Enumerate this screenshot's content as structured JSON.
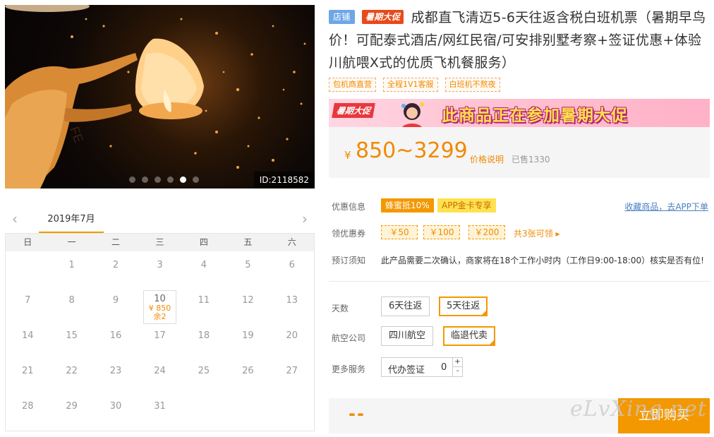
{
  "photo": {
    "id_label": "ID:2118582",
    "dots_count": 6,
    "active_dot_index": 4
  },
  "calendar": {
    "prev_icon": "chevron-left-icon",
    "next_icon": "chevron-right-icon",
    "month_label": "2019年7月",
    "weekdays": [
      "日",
      "一",
      "二",
      "三",
      "四",
      "五",
      "六"
    ],
    "days": [
      "",
      "1",
      "2",
      "3",
      "4",
      "5",
      "6",
      "7",
      "8",
      "9",
      "10",
      "11",
      "12",
      "13",
      "14",
      "15",
      "16",
      "17",
      "18",
      "19",
      "20",
      "21",
      "22",
      "23",
      "24",
      "25",
      "26",
      "27",
      "28",
      "29",
      "30",
      "31"
    ],
    "available": {
      "day": "10",
      "price": "¥ 850",
      "stock": "余2"
    }
  },
  "product": {
    "tag_shop": "店铺",
    "tag_promo": "暑期大促",
    "title": "成都直飞清迈5-6天往返含税白班机票（暑期早鸟价！可配泰式酒店/网红民宿/可安排别墅考察+签证优惠+体验川航喂X式的优质飞机餐服务）",
    "features": [
      "包机商直营",
      "全程1V1客服",
      "白班机不熬夜"
    ]
  },
  "banner": {
    "tag": "暑期大促",
    "text": "此商品正在参加暑期大促"
  },
  "price": {
    "currency": "¥",
    "range": "850~3299",
    "note_link": "价格说明",
    "sold": "已售1330"
  },
  "info": {
    "discount_label": "优惠信息",
    "discount_badge": "蜂蜜抵10%",
    "app_badge": "APP金卡专享",
    "favorite_link": "收藏商品，去APP下单",
    "coupon_label": "领优惠券",
    "coupons": [
      "￥50",
      "￥100",
      "￥200"
    ],
    "coupon_more": "共3张可领 ▸",
    "notice_label": "预订须知",
    "notice_text": "此产品需要二次确认，商家将在18个工作小时内（工作日9:00-18:00）核实是否有位!"
  },
  "options": {
    "days_label": "天数",
    "days": [
      "6天往返",
      "5天往返"
    ],
    "days_selected": 1,
    "airline_label": "航空公司",
    "airlines": [
      "四川航空",
      "临退代卖"
    ],
    "airline_selected": 1,
    "service_label": "更多服务",
    "service_name": "代办签证",
    "service_qty": "0",
    "plus": "+",
    "minus": "-"
  },
  "buy": {
    "total": "--",
    "button": "立即购买"
  },
  "watermark": "eLvXing.net",
  "colors": {
    "accent": "#f39800",
    "price": "#f08a00",
    "link": "#4a7fc1",
    "shop_tag": "#6ea7e6",
    "promo_tag": "#e84a1b"
  }
}
